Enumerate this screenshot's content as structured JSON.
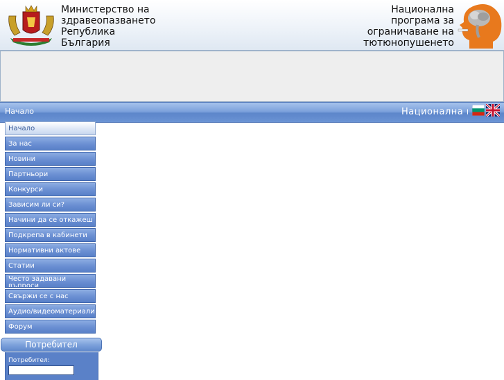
{
  "header": {
    "ministry_lines": [
      "Министерство на",
      "здравеопазването",
      "Република",
      "България"
    ],
    "program_lines": [
      "Национална",
      "програма за",
      "ограничаване на",
      "тютюнопушенето"
    ]
  },
  "navbar": {
    "home_label": "Начало",
    "marquee_text": "Национална п"
  },
  "menu": {
    "items": [
      "Начало",
      "За нас",
      "Новини",
      "Партньори",
      "Конкурси",
      "Зависим ли си?",
      "Начини да се откажеш",
      "Подкрепа в кабинети",
      "Нормативни актове",
      "Статии",
      "Често задавани въпроси",
      "Свържи се с нас",
      "Аудио/видеоматериали",
      "Форум"
    ],
    "active_index": 0
  },
  "user_box": {
    "title": "Потребител",
    "username_label": "Потребител:",
    "username_value": ""
  },
  "icons": {
    "coat": "bulgarian-coat-of-arms-icon",
    "head": "head-smoke-logo-icon",
    "flag_bg": "bulgarian-flag-icon",
    "flag_uk": "uk-flag-icon"
  },
  "colors": {
    "nav_blue": "#6a93d4",
    "menu_blue": "#6d91d4",
    "logo_orange": "#e8791d"
  }
}
